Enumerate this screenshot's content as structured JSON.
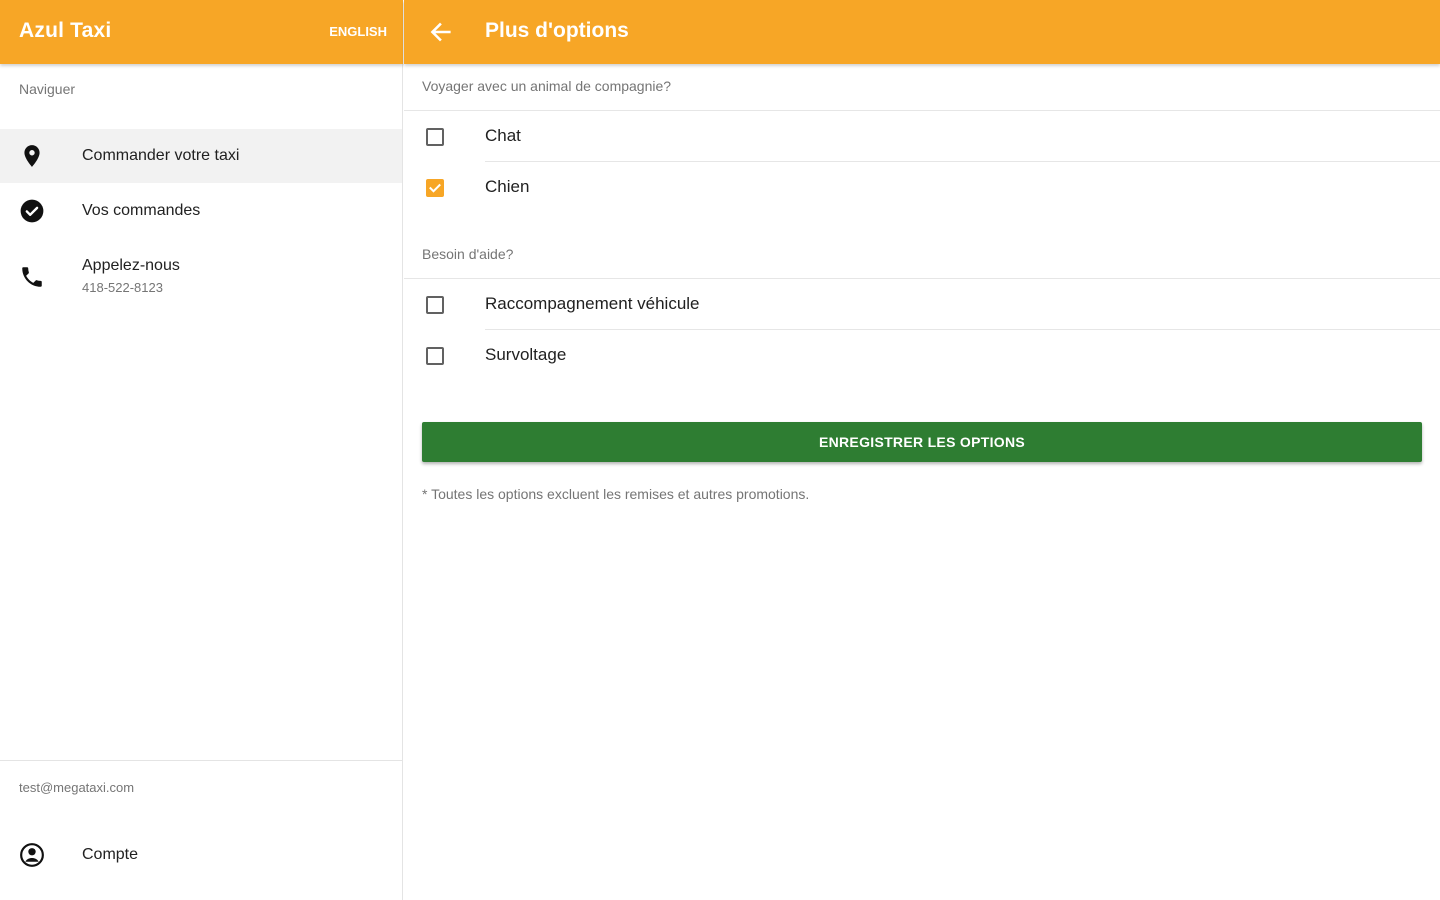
{
  "drawer": {
    "title": "Azul Taxi",
    "language_button": "ENGLISH",
    "subheader": "Naviguer",
    "items": [
      {
        "label": "Commander votre taxi",
        "icon": "location-pin-icon"
      },
      {
        "label": "Vos commandes",
        "icon": "check-circle-icon"
      },
      {
        "label": "Appelez-nous",
        "sublabel": "418-522-8123",
        "icon": "phone-icon"
      }
    ],
    "account_email": "test@megataxi.com",
    "account_label": "Compte"
  },
  "main": {
    "title": "Plus d'options",
    "pets_header": "Voyager avec un animal de compagnie?",
    "pet_options": [
      {
        "label": "Chat",
        "checked": false
      },
      {
        "label": "Chien",
        "checked": true
      }
    ],
    "help_header": "Besoin d'aide?",
    "help_options": [
      {
        "label": "Raccompagnement véhicule",
        "checked": false
      },
      {
        "label": "Survoltage",
        "checked": false
      }
    ],
    "save_button": "ENREGISTRER LES OPTIONS",
    "footnote": "* Toutes les options excluent les remises et autres promotions."
  },
  "colors": {
    "toolbar": "#f7a626",
    "accent": "#f7a626",
    "save_button": "#2e7d32"
  }
}
